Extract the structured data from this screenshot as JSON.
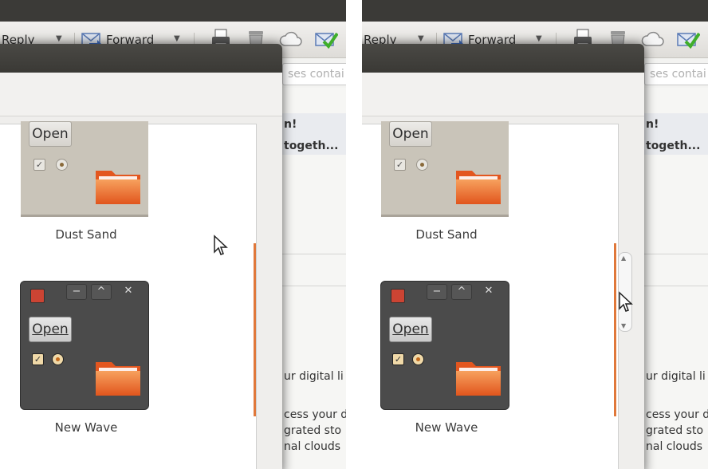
{
  "mail": {
    "reply_label": "o Reply",
    "forward_label": "Forward",
    "search_placeholder": "ses contai",
    "message_subject_1": "n!",
    "message_subject_2": "togeth...",
    "body_line_1": "ur digital li",
    "body_line_2": "cess your d",
    "body_line_3": "grated sto",
    "body_line_4": "nal clouds"
  },
  "themes": [
    {
      "name": "Dust Sand",
      "button": "Open"
    },
    {
      "name": "New Wave",
      "button": "Open"
    }
  ],
  "colors": {
    "accent_orange": "#e0783a",
    "title_bar": "#3b3a37"
  },
  "icons": [
    "forward-icon",
    "print-icon",
    "trash-icon",
    "cloud-icon",
    "mark-read-icon",
    "folder-icon",
    "pointer-cursor-icon"
  ]
}
